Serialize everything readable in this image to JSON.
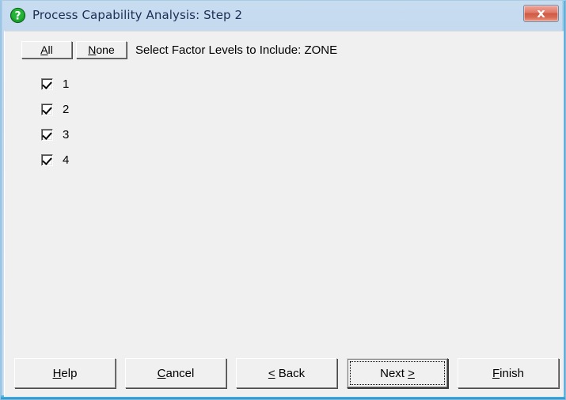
{
  "window": {
    "title": "Process Capability Analysis: Step 2",
    "icon": "question-mark-icon",
    "close_label": "×",
    "titlebar_color": "#c8dcf0",
    "client_color": "#f0f0f0",
    "accent_color": "#3ea8dc"
  },
  "toolbar": {
    "all_label": "All",
    "all_accel": "A",
    "all_rest": "ll",
    "none_label": "None",
    "none_accel": "N",
    "none_rest": "one"
  },
  "prompt": {
    "text": "Select Factor Levels to Include: ZONE",
    "factor_name": "ZONE"
  },
  "factor_levels": [
    {
      "label": "1",
      "checked": true
    },
    {
      "label": "2",
      "checked": true
    },
    {
      "label": "3",
      "checked": true
    },
    {
      "label": "4",
      "checked": true
    }
  ],
  "footer": {
    "buttons": [
      {
        "accel": "H",
        "rest": "elp",
        "full": "Help",
        "default": false
      },
      {
        "accel": "C",
        "rest": "ancel",
        "full": "Cancel",
        "default": false
      },
      {
        "accel": "<",
        "rest": " Back",
        "full": "< Back",
        "default": false
      },
      {
        "accel": "",
        "rest": "",
        "full": "Next >",
        "default": true
      },
      {
        "accel": "F",
        "rest": "inish",
        "full": "Finish",
        "default": false
      }
    ],
    "next_prefix": "Next ",
    "next_accel": ">"
  }
}
